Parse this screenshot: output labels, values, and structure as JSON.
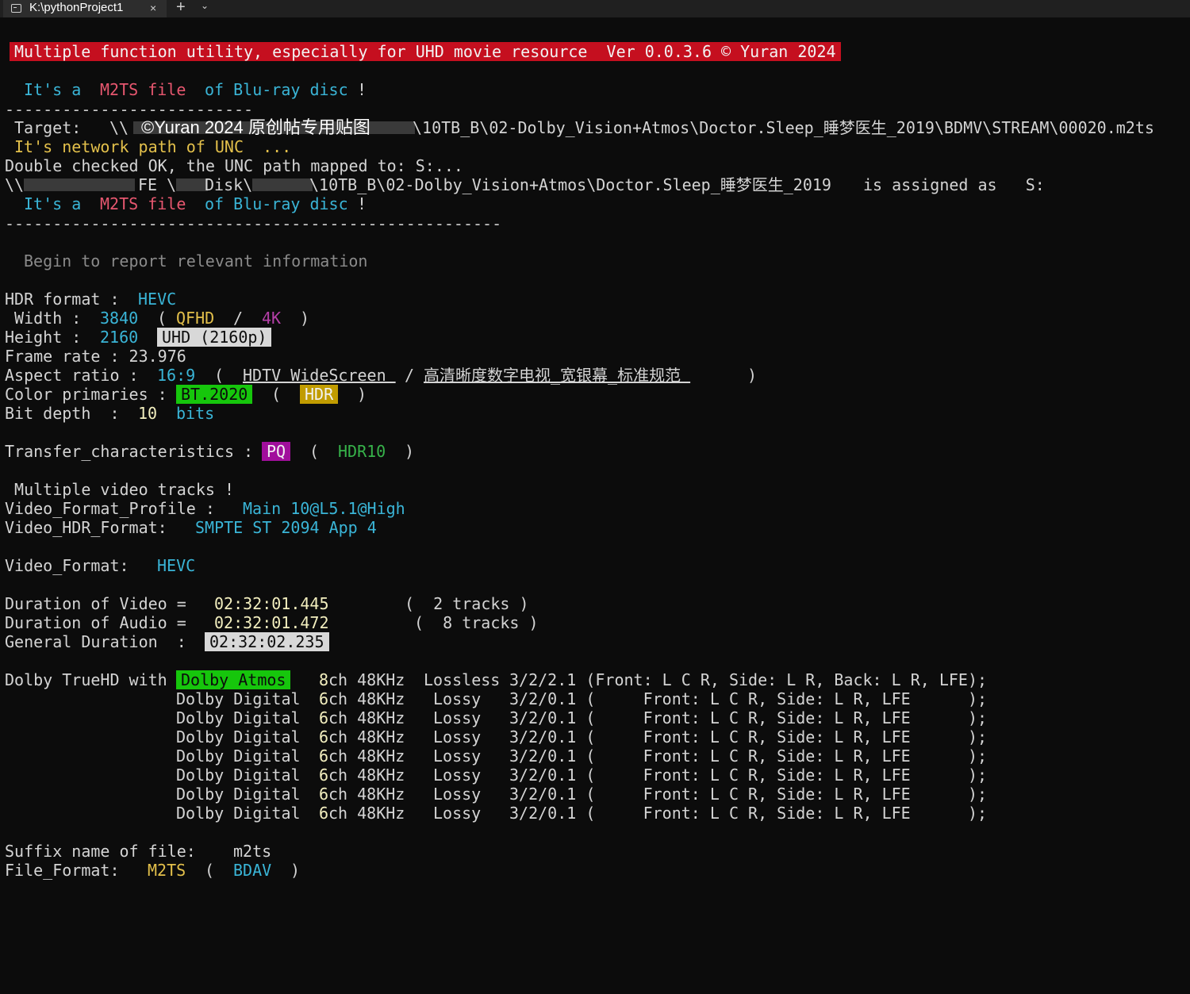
{
  "window": {
    "tab_title": "K:\\pythonProject1",
    "close_glyph": "×",
    "newtab_glyph": "+",
    "dropdown_glyph": "⌄"
  },
  "banner": "Multiple function utility, especially for UHD movie resource  Ver 0.0.3.6 © Yuran 2024",
  "file_check1": {
    "a": "It's a",
    "b": "M2TS file",
    "c": "of Blu-ray disc",
    "d": "!"
  },
  "dash_short": "--------------------------",
  "target": {
    "label": "Target:",
    "prefix": "\\\\",
    "watermark": "©Yuran 2024 原创帖专用贴图",
    "path": "\\10TB_B\\02-Dolby_Vision+Atmos\\Doctor.Sleep_睡梦医生_2019\\BDMV\\STREAM\\00020.m2ts"
  },
  "unc_note": "It's network path of UNC  ...",
  "unc_ok": "Double checked OK, the UNC path mapped to: S:...",
  "unc_map": {
    "prefix": "\\\\",
    "p1": "FE",
    "p2": "\\",
    "p3": "Disk\\",
    "path": "\\10TB_B\\02-Dolby_Vision+Atmos\\Doctor.Sleep_睡梦医生_2019",
    "assigned": "is assigned as   S:"
  },
  "file_check2": {
    "a": "It's a",
    "b": "M2TS file",
    "c": "of Blu-ray disc",
    "d": "!"
  },
  "dash_long": "----------------------------------------------------",
  "begin": "Begin to report relevant information",
  "hdr": {
    "label": "HDR format :",
    "value": "HEVC"
  },
  "width": {
    "label": " Width :",
    "value": "3840",
    "open": "(",
    "v1": "QFHD",
    "sep": "/",
    "v2": "4K",
    "close": ")"
  },
  "height": {
    "label": "Height :",
    "value": "2160",
    "badge": "UHD (2160p)"
  },
  "frame_rate": "Frame rate : 23.976",
  "aspect": {
    "label": "Aspect ratio :",
    "value": "16:9",
    "open": "(",
    "en": "HDTV WideScreen ",
    "sep": "/",
    "zh": "高清晰度数字电视_宽银幕_标准规范 ",
    "close": ")"
  },
  "color": {
    "label": "Color primaries :",
    "value": "BT.2020",
    "open": "(",
    "badge": "HDR",
    "close": ")"
  },
  "bit_depth": {
    "label": "Bit depth  :",
    "value": "10",
    "unit": "bits"
  },
  "transfer": {
    "label": "Transfer_characteristics :",
    "badge": "PQ",
    "open": "(",
    "value": "HDR10",
    "close": ")"
  },
  "multi_video": " Multiple video tracks !",
  "profile": {
    "label": "Video_Format_Profile :",
    "value": "Main 10@L5.1@High"
  },
  "hdr_format": {
    "label": "Video_HDR_Format:",
    "value": "SMPTE ST 2094 App 4"
  },
  "video_format": {
    "label": "Video_Format:",
    "value": "HEVC"
  },
  "dur_video": {
    "label": "Duration of Video =",
    "value": "02:32:01.445",
    "tracks": "(  2 tracks )"
  },
  "dur_audio": {
    "label": "Duration of Audio =",
    "value": "02:32:01.472",
    "tracks": "(  8 tracks )"
  },
  "dur_general": {
    "label": "General Duration  :",
    "value": "02:32:02.235"
  },
  "audio_lead": {
    "label": "Dolby TrueHD with",
    "badge": "Dolby Atmos"
  },
  "audio": [
    {
      "n": "8",
      "ch": "ch 48KHz",
      "type": "Lossless",
      "rest": "3/2/2.1 (Front: L C R, Side: L R, Back: L R, LFE);"
    },
    {
      "name": "Dolby Digital",
      "n": "6",
      "ch": "ch 48KHz",
      "type": "Lossy",
      "rest": "3/2/0.1 (     Front: L C R, Side: L R, LFE      );"
    },
    {
      "name": "Dolby Digital",
      "n": "6",
      "ch": "ch 48KHz",
      "type": "Lossy",
      "rest": "3/2/0.1 (     Front: L C R, Side: L R, LFE      );"
    },
    {
      "name": "Dolby Digital",
      "n": "6",
      "ch": "ch 48KHz",
      "type": "Lossy",
      "rest": "3/2/0.1 (     Front: L C R, Side: L R, LFE      );"
    },
    {
      "name": "Dolby Digital",
      "n": "6",
      "ch": "ch 48KHz",
      "type": "Lossy",
      "rest": "3/2/0.1 (     Front: L C R, Side: L R, LFE      );"
    },
    {
      "name": "Dolby Digital",
      "n": "6",
      "ch": "ch 48KHz",
      "type": "Lossy",
      "rest": "3/2/0.1 (     Front: L C R, Side: L R, LFE      );"
    },
    {
      "name": "Dolby Digital",
      "n": "6",
      "ch": "ch 48KHz",
      "type": "Lossy",
      "rest": "3/2/0.1 (     Front: L C R, Side: L R, LFE      );"
    },
    {
      "name": "Dolby Digital",
      "n": "6",
      "ch": "ch 48KHz",
      "type": "Lossy",
      "rest": "3/2/0.1 (     Front: L C R, Side: L R, LFE      );"
    }
  ],
  "suffix": {
    "label": "Suffix name of file:",
    "value": "m2ts"
  },
  "file_format": {
    "label": "File_Format:",
    "value": "M2TS",
    "open": "(",
    "v2": "BDAV",
    "close": ")"
  }
}
